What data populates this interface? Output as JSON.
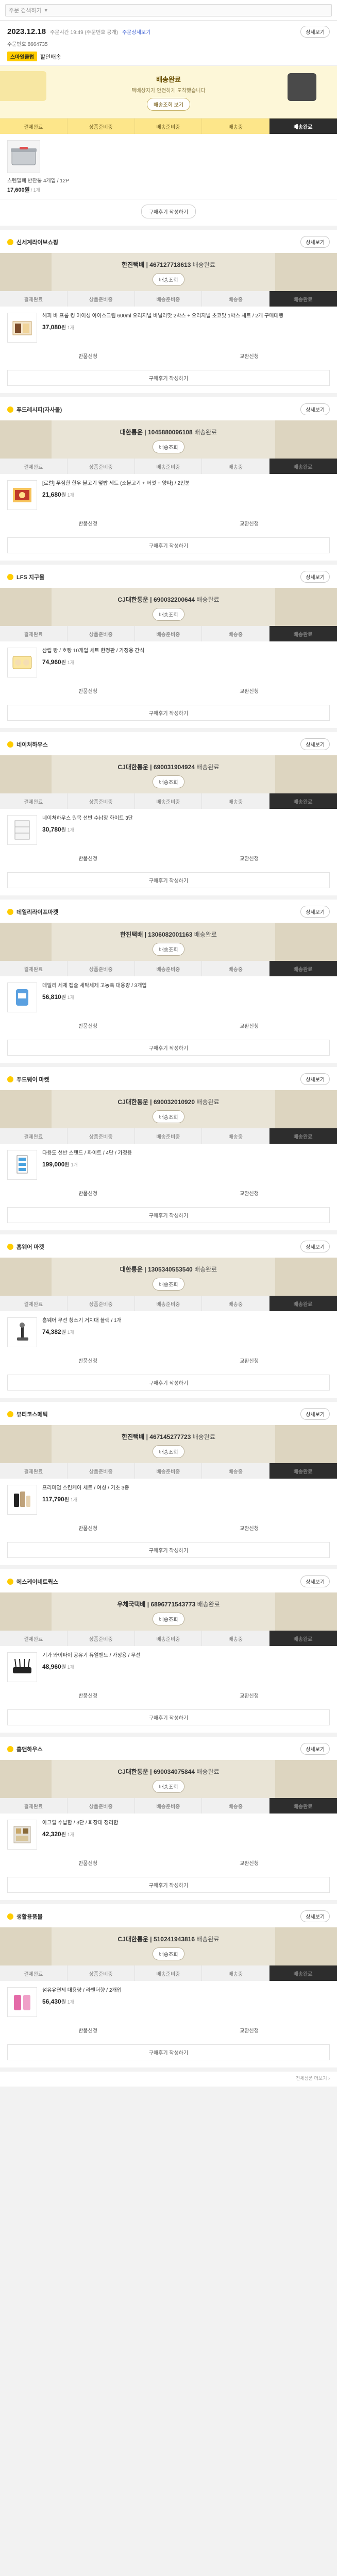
{
  "topbar": {
    "search_text": "주문 검색하기",
    "caret": "▼"
  },
  "order": {
    "date": "2023.12.18",
    "sub": "주문시간 19:49 (주문번호 공개)",
    "link": "주문상세보기",
    "number": "주문번호 8664735",
    "detail_button": "상세보기",
    "seller_badge": "스마일클럽",
    "seller_label": "할인배송"
  },
  "banner": {
    "title": "배송완료",
    "desc": "택배상자가 안전하게 도착했습니다",
    "cta": "배송조회 보기"
  },
  "steps": [
    "결제완료",
    "상품준비중",
    "배송준비중",
    "배송중",
    "배송완료"
  ],
  "first_item": {
    "name": "스텐밀폐 반찬통 4개입 / 12P",
    "price": "17,600원",
    "qty": "/ 1개"
  },
  "review_button": "구매후기 작성하기",
  "sections": [
    {
      "seller": "신세계라이브쇼핑",
      "detail": "상세보기",
      "carrier": "한진택배 | 467127718613",
      "carrier_tail": "배송완료",
      "ship_cta": "배송조회",
      "product_name": "해피 바 프롬 킹 아이싱 아이스크림 600ml 오리지널 바닐라맛 2박스 + 오리지널 초코맛 1박스 세트",
      "product_detail": "/ 2개 구매대행",
      "price": "37,080",
      "unit": "원",
      "qty": "1개",
      "icon": "ice-cream",
      "actions": [
        "반품신청",
        "교환신청"
      ]
    },
    {
      "seller": "푸드레시피(자사몰)",
      "detail": "상세보기",
      "carrier": "대한통운 | 1045880096108",
      "carrier_tail": "배송완료",
      "ship_cta": "배송조회",
      "product_name": "[로컬] 푸짐한 한우 불고기 덮밥 세트 (소불고기 + 버섯 + 양파) / 2인분",
      "product_detail": "",
      "price": "21,680",
      "unit": "원",
      "qty": "1개",
      "icon": "food",
      "actions": [
        "반품신청",
        "교환신청"
      ]
    },
    {
      "seller": "LFS 지구몰",
      "detail": "상세보기",
      "carrier": "CJ대한통운 | 690032200644",
      "carrier_tail": "배송완료",
      "ship_cta": "배송조회",
      "product_name": "삼립 빵 / 호빵 10개입 세트 한정판 / 가정용 간식",
      "product_detail": "",
      "price": "74,960",
      "unit": "원",
      "qty": "1개",
      "icon": "bread",
      "actions": [
        "반품신청",
        "교환신청"
      ]
    },
    {
      "seller": "네이처하우스",
      "detail": "상세보기",
      "carrier": "CJ대한통운 | 690031904924",
      "carrier_tail": "배송완료",
      "ship_cta": "배송조회",
      "product_name": "네이처하우스 원목 선반 수납장 화이트 3단",
      "product_detail": "",
      "price": "30,780",
      "unit": "원",
      "qty": "1개",
      "icon": "shelf",
      "actions": [
        "반품신청",
        "교환신청"
      ]
    },
    {
      "seller": "데일리라이프마켓",
      "detail": "상세보기",
      "carrier": "한진택배 | 1306082001163",
      "carrier_tail": "배송완료",
      "ship_cta": "배송조회",
      "product_name": "데일리 세제 캡슐 세탁세제 고농축 대용량 / 3개입",
      "product_detail": "",
      "price": "56,810",
      "unit": "원",
      "qty": "1개",
      "icon": "detergent",
      "actions": [
        "반품신청",
        "교환신청"
      ]
    },
    {
      "seller": "푸드웨이 마켓",
      "detail": "상세보기",
      "carrier": "CJ대한통운 | 690032010920",
      "carrier_tail": "배송완료",
      "ship_cta": "배송조회",
      "product_name": "다용도 선반 스탠드 / 화이트 / 4단 / 가정용",
      "product_detail": "",
      "price": "199,000",
      "unit": "원",
      "qty": "1개",
      "icon": "stand",
      "actions": [
        "반품신청",
        "교환신청"
      ]
    },
    {
      "seller": "홈웨어 마켓",
      "detail": "상세보기",
      "carrier": "대한통운 | 1305340553540",
      "carrier_tail": "배송완료",
      "ship_cta": "배송조회",
      "product_name": "홈웨어 무선 청소기 거치대 블랙 / 1개",
      "product_detail": "",
      "price": "74,382",
      "unit": "원",
      "qty": "1개",
      "icon": "vacuum",
      "actions": [
        "반품신청",
        "교환신청"
      ]
    },
    {
      "seller": "뷰티코스메틱",
      "detail": "상세보기",
      "carrier": "한진택배 | 467145277723",
      "carrier_tail": "배송완료",
      "ship_cta": "배송조회",
      "product_name": "프리미엄 스킨케어 세트 / 여성 / 기초 3종",
      "product_detail": "",
      "price": "117,790",
      "unit": "원",
      "qty": "1개",
      "icon": "cosmetic",
      "actions": [
        "반품신청",
        "교환신청"
      ]
    },
    {
      "seller": "에스케이네트웍스",
      "detail": "상세보기",
      "carrier": "우체국택배 | 6896771543773",
      "carrier_tail": "배송완료",
      "ship_cta": "배송조회",
      "product_name": "기가 와이파이 공유기 듀얼밴드 / 가정용 / 무선",
      "product_detail": "",
      "price": "48,960",
      "unit": "원",
      "qty": "1개",
      "icon": "router",
      "actions": [
        "반품신청",
        "교환신청"
      ]
    },
    {
      "seller": "홈앤하우스",
      "detail": "상세보기",
      "carrier": "CJ대한통운 | 690034075844",
      "carrier_tail": "배송완료",
      "ship_cta": "배송조회",
      "product_name": "아크릴 수납함 / 3단 / 화장대 정리함",
      "product_detail": "",
      "price": "42,320",
      "unit": "원",
      "qty": "1개",
      "icon": "organizer",
      "actions": [
        "반품신청",
        "교환신청"
      ]
    },
    {
      "seller": "생활용품몰",
      "detail": "상세보기",
      "carrier": "CJ대한통운 | 510241943816",
      "carrier_tail": "배송완료",
      "ship_cta": "배송조회",
      "product_name": "섬유유연제 대용량 / 라벤더향 / 2개입",
      "product_detail": "",
      "price": "56,430",
      "unit": "원",
      "qty": "1개",
      "icon": "softener",
      "actions": [
        "반품신청",
        "교환신청"
      ]
    }
  ],
  "footer_note": "전체상품 더보기 ›"
}
